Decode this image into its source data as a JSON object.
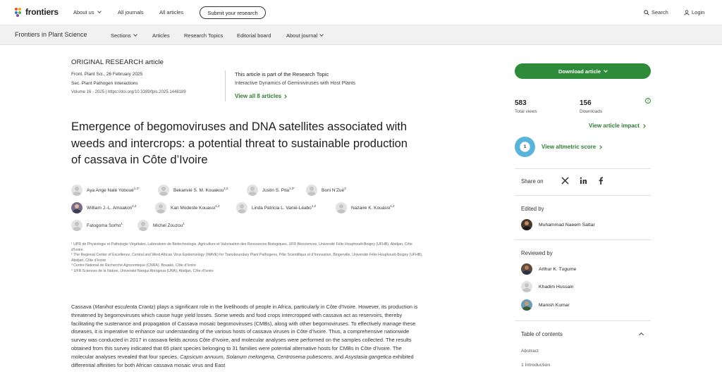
{
  "topnav": {
    "brand": "frontiers",
    "items": [
      "About us",
      "All journals",
      "All articles"
    ],
    "submit": "Submit your research",
    "search": "Search",
    "login": "Login"
  },
  "journalnav": {
    "title": "Frontiers in Plant Science",
    "items": [
      "Sections",
      "Articles",
      "Research Topics",
      "Editorial board",
      "About journal"
    ]
  },
  "article": {
    "type": "ORIGINAL RESEARCH article",
    "citation": "Front. Plant Sci., 26 February 2025",
    "section": "Sec. Plant Pathogen Interactions",
    "volume": "Volume 16 - 2025 | https://doi.org/10.3389/fpls.2025.1448189",
    "research_topic_head": "This article is part of the Research Topic",
    "research_topic_title": "Interactive Dynamics of Geminiviruses with Host Plants",
    "view_all": "View all 8 articles",
    "title": "Emergence of begomoviruses and DNA satellites associated with weeds and intercrops: a potential threat to sustainable production of cassava in Côte d’Ivoire",
    "authors": [
      {
        "name": "Aya Ange Naté Yoboué",
        "sup": "1,2*"
      },
      {
        "name": "Bekanvié S. M. Kouakou",
        "sup": "1,2"
      },
      {
        "name": "Justin S. Pita",
        "sup": "1,2*"
      },
      {
        "name": "Boni N’Zué",
        "sup": "3"
      },
      {
        "name": "William J.-L. Amoakon",
        "sup": "2,4"
      },
      {
        "name": "Kan Modeste Kouassi",
        "sup": "1,2"
      },
      {
        "name": "Linda Patricia L. Vanié-Léabo",
        "sup": "1,2"
      },
      {
        "name": "Nazaire K. Kouassi",
        "sup": "1,2"
      },
      {
        "name": "Fatogoma Sorho",
        "sup": "1"
      },
      {
        "name": "Michel Zouzou",
        "sup": "1"
      }
    ],
    "affiliations": [
      "¹ UPR de Physiologie et Pathologie Végétales, Laboratoire de Biotechnologie, Agriculture et Valorisation des Ressources Biologiques, UFR Biosciences, Université Félix Houphouët-Boigny (UFHB), Abidjan, Côte d’Ivoire",
      "² The Regional Center of Excellence, Central and West African Virus Epidemiology (WAVE) for Transboundary Plant Pathogens, Pôle Scientifique et d’Innovation, Bingerville, Université Félix Houphouët-Boigny (UFHB), Abidjan, Côte d’Ivoire",
      "³ Centre National de Recherche Agronomique (CNRA), Bouaké, Côte d’Ivoire",
      "⁴ UFR Sciences de la Nature, Université Nangui Abrogoua (UNA), Abidjan, Côte d’Ivoire"
    ],
    "abstract": [
      "Cassava (",
      "Manihot esculenta",
      " Crantz) plays a significant role in the livelihoods of people in Africa, particularly in Côte d’Ivoire. However, its production is threatened by begomoviruses which cause huge yield losses. Some weeds and food crops intercropped with cassava act as reservoirs, thereby facilitating the sustenance and propagation of Cassava mosaic begomoviruses (CMBs), along with other begomoviruses. To effectively manage these diseases, it is imperative to enhance our understanding of the various hosts of cassava viruses in Côte d’Ivoire. Thus, a comprehensive nationwide survey was conducted in 2017 in cassava fields across Côte d’Ivoire, and molecular analyses were performed on the samples collected. The results obtained from this survey indicated that 65 plant species belonging to 31 families were potential alternative hosts for CMBs in Côte d’Ivoire. The molecular analyses revealed that four species, ",
      "Capsicum annuum, Solanum melongena, Centrosema pubescens",
      ", and ",
      "Asystasia gangetica",
      " exhibited differential affinities for both African cassava mosaic virus and East"
    ]
  },
  "sidebar": {
    "download": "Download article",
    "views_num": "583",
    "views_lbl": "Total views",
    "downloads_num": "156",
    "downloads_lbl": "Downloads",
    "impact": "View article impact",
    "altmetric_score": "1",
    "altmetric": "View altmetric score",
    "share": "Share on",
    "edited_by": "Edited by",
    "editor": "Muhammad Naeem Sattar",
    "reviewed_by": "Reviewed by",
    "reviewers": [
      "Arthur K. Tugume",
      "Khadim Hussain",
      "Manish Kumar"
    ],
    "toc": "Table of contents",
    "toc_items": [
      "Abstract",
      "1 Introduction"
    ]
  },
  "colors": {
    "accent": "#2e8b3a",
    "link": "#2e7d32",
    "navbg": "#f1f1f1"
  }
}
